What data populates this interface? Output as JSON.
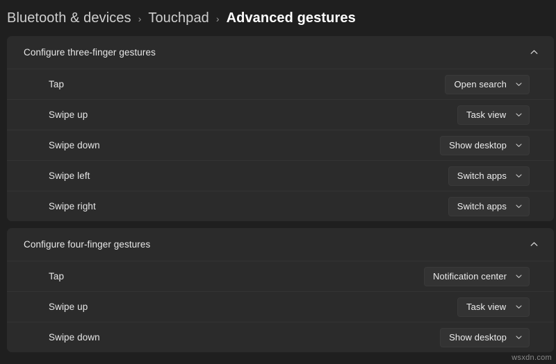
{
  "breadcrumb": {
    "items": [
      {
        "label": "Bluetooth & devices",
        "current": false
      },
      {
        "label": "Touchpad",
        "current": false
      },
      {
        "label": "Advanced gestures",
        "current": true
      }
    ],
    "separator": "›"
  },
  "icons": {
    "collapse": "chevron-up-icon",
    "expand": "chevron-down-icon"
  },
  "sections": [
    {
      "title": "Configure three-finger gestures",
      "expanded": true,
      "rows": [
        {
          "label": "Tap",
          "value": "Open search"
        },
        {
          "label": "Swipe up",
          "value": "Task view"
        },
        {
          "label": "Swipe down",
          "value": "Show desktop"
        },
        {
          "label": "Swipe left",
          "value": "Switch apps"
        },
        {
          "label": "Swipe right",
          "value": "Switch apps"
        }
      ]
    },
    {
      "title": "Configure four-finger gestures",
      "expanded": true,
      "rows": [
        {
          "label": "Tap",
          "value": "Notification center"
        },
        {
          "label": "Swipe up",
          "value": "Task view"
        },
        {
          "label": "Swipe down",
          "value": "Show desktop"
        }
      ]
    }
  ],
  "watermark": "wsxdn.com",
  "colors": {
    "page_background": "#1f1f1f",
    "card_background": "#2b2b2b",
    "dropdown_background": "#333333",
    "divider": "#343434",
    "text_primary": "#ffffff",
    "text_secondary": "#cfcfcf"
  }
}
